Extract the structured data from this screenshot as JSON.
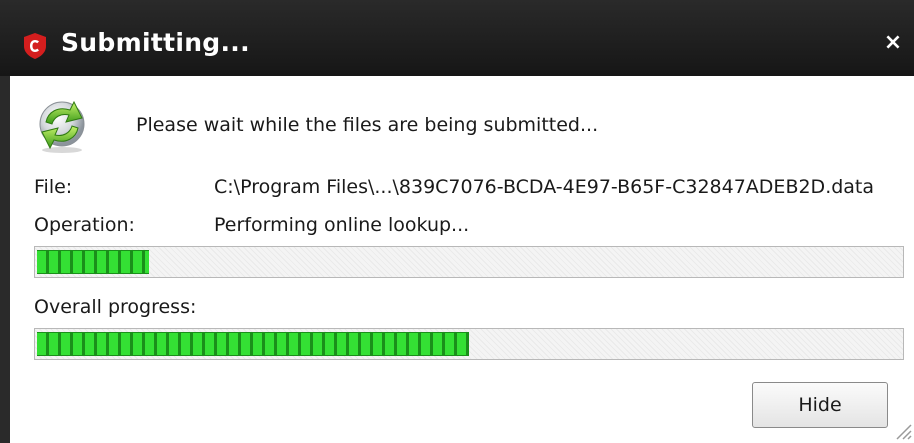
{
  "window": {
    "title": "Submitting...",
    "close_glyph": "×"
  },
  "icons": {
    "app_logo": "comodo-logo-icon",
    "status": "refresh-check-icon",
    "close": "close-icon",
    "resize": "resize-grip-icon"
  },
  "colors": {
    "titlebar": "#1f1f1f",
    "logo_red": "#d41e1e",
    "progress_green": "#2fd12f"
  },
  "message": "Please wait while the files are being submitted...",
  "file": {
    "label": "File:",
    "value": "C:\\Program Files\\...\\839C7076-BCDA-4E97-B65F-C32847ADEB2D.data"
  },
  "operation": {
    "label": "Operation:",
    "value": "Performing online lookup..."
  },
  "overall": {
    "label": "Overall progress:"
  },
  "progress": {
    "file_fraction": 0.13,
    "overall_fraction": 0.5
  },
  "buttons": {
    "hide": "Hide"
  }
}
